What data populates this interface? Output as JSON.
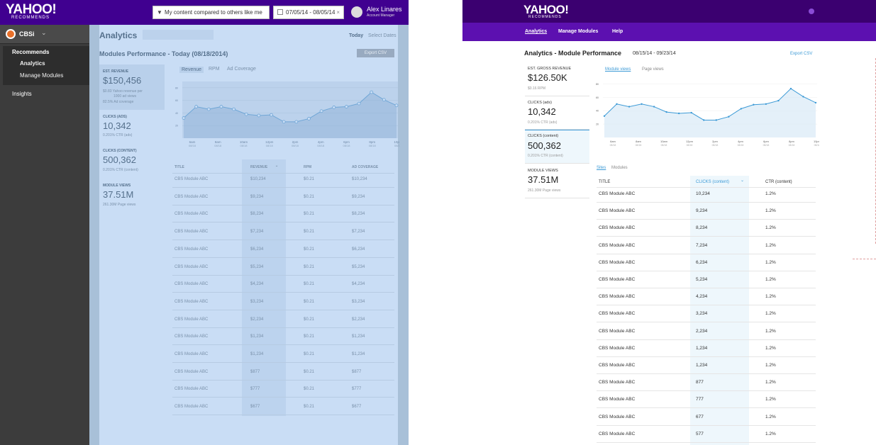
{
  "left": {
    "logo": "YAHOO!",
    "logo_sub": "RECOMMENDS",
    "compare_filter": "My content compared to others like me",
    "date_range": "07/05/14 - 08/05/14",
    "date_clear": "×",
    "user_name": "Alex Linares",
    "user_role": "Account Manager",
    "brand_name": "CBSi",
    "nav": {
      "recommends": "Recommends",
      "analytics": "Analytics",
      "manage_modules": "Manage Modules",
      "insights": "Insights"
    },
    "page_title": "Analytics",
    "today": "Today",
    "select_dates": "Select Dates",
    "subtitle": "Modules Performance - Today (08/18/2014)",
    "export": "Export CSV",
    "metrics": [
      {
        "label": "EST. REVENUE",
        "value": "$150,456",
        "sub1": "$0.83  Yahoo revenue per",
        "sub2": "1000 ad views",
        "sub3": "82.5%  Ad coverage"
      },
      {
        "label": "CLICKS (ADS)",
        "value": "10,342",
        "sub1": "0.201%  CTR (ads)"
      },
      {
        "label": "CLICKS (CONTENT)",
        "value": "500,362",
        "sub1": "0.201%  CTR (content)"
      },
      {
        "label": "MODULE VIEWS",
        "value": "37.51M",
        "sub1": "261.30M  Page views"
      }
    ],
    "tabs": [
      "Revenue",
      "RPM",
      "Ad Coverage"
    ],
    "table_headers": [
      "TITLE",
      "REVENUE",
      "RPM",
      "AD COVERAGE"
    ],
    "rows": [
      [
        "CBS Module ABC",
        "$10,234",
        "$0.21",
        "$10,234"
      ],
      [
        "CBS Module ABC",
        "$9,234",
        "$0.21",
        "$9,234"
      ],
      [
        "CBS Module ABC",
        "$8,234",
        "$0.21",
        "$8,234"
      ],
      [
        "CBS Module ABC",
        "$7,234",
        "$0.21",
        "$7,234"
      ],
      [
        "CBS Module ABC",
        "$6,234",
        "$0.21",
        "$6,234"
      ],
      [
        "CBS Module ABC",
        "$5,234",
        "$0.21",
        "$5,234"
      ],
      [
        "CBS Module ABC",
        "$4,234",
        "$0.21",
        "$4,234"
      ],
      [
        "CBS Module ABC",
        "$3,234",
        "$0.21",
        "$3,234"
      ],
      [
        "CBS Module ABC",
        "$2,234",
        "$0.21",
        "$2,234"
      ],
      [
        "CBS Module ABC",
        "$1,234",
        "$0.21",
        "$1,234"
      ],
      [
        "CBS Module ABC",
        "$1,234",
        "$0.21",
        "$1,234"
      ],
      [
        "CBS Module ABC",
        "$877",
        "$0.21",
        "$877"
      ],
      [
        "CBS Module ABC",
        "$777",
        "$0.21",
        "$777"
      ],
      [
        "CBS Module ABC",
        "$677",
        "$0.21",
        "$677"
      ]
    ]
  },
  "right": {
    "logo": "YAHOO!",
    "logo_sub": "RECOMMENDS",
    "nav": [
      "Analytics",
      "Manage Modules",
      "Help"
    ],
    "title": "Analytics - Module Performance",
    "range": "08/15/14 - 09/23/14",
    "export": "Export CSV",
    "metrics": [
      {
        "label": "EST. GROSS REVENUE",
        "value": "$126.50K",
        "sub": "$0.16  RPM"
      },
      {
        "label": "CLICKS (ads)",
        "value": "10,342",
        "sub": "0.201%  CTR (ads)"
      },
      {
        "label": "CLICKS (content)",
        "value": "500,362",
        "sub": "0.201%  CTR (content)"
      },
      {
        "label": "MODULE VIEWS",
        "value": "37.51M",
        "sub": "261.30M  Page views"
      }
    ],
    "chart_tabs": [
      "Module views",
      "Page views"
    ],
    "table_tabs": [
      "Sites",
      "Modules"
    ],
    "table_headers": [
      "TITLE",
      "CLICKS (content)",
      "CTR (content)"
    ],
    "sort_icon": "⌄",
    "rows": [
      [
        "CBS Module ABC",
        "10,234",
        "1.2%"
      ],
      [
        "CBS Module ABC",
        "9,234",
        "1.2%"
      ],
      [
        "CBS Module ABC",
        "8,234",
        "1.2%"
      ],
      [
        "CBS Module ABC",
        "7,234",
        "1.2%"
      ],
      [
        "CBS Module ABC",
        "6,234",
        "1.2%"
      ],
      [
        "CBS Module ABC",
        "5,234",
        "1.2%"
      ],
      [
        "CBS Module ABC",
        "4,234",
        "1.2%"
      ],
      [
        "CBS Module ABC",
        "3,234",
        "1.2%"
      ],
      [
        "CBS Module ABC",
        "2,234",
        "1.2%"
      ],
      [
        "CBS Module ABC",
        "1,234",
        "1.2%"
      ],
      [
        "CBS Module ABC",
        "1,234",
        "1.2%"
      ],
      [
        "CBS Module ABC",
        "877",
        "1.2%"
      ],
      [
        "CBS Module ABC",
        "777",
        "1.2%"
      ],
      [
        "CBS Module ABC",
        "677",
        "1.2%"
      ],
      [
        "CBS Module ABC",
        "577",
        "1.2%"
      ]
    ]
  },
  "chart_data": [
    {
      "type": "area",
      "x": [
        "6am",
        "8am",
        "10am",
        "12pm",
        "2pm",
        "4pm",
        "6pm",
        "8pm",
        "10pm"
      ],
      "x_sub": [
        "08/18",
        "08/18",
        "08/18",
        "08/18",
        "08/18",
        "08/18",
        "08/18",
        "08/18",
        "08/18"
      ],
      "y_ticks": [
        "80",
        "60",
        "40",
        "20"
      ],
      "ylim": [
        0,
        90
      ],
      "values": [
        32,
        50,
        46,
        50,
        46,
        38,
        36,
        37,
        26,
        26,
        31,
        43,
        49,
        50,
        55,
        73,
        61,
        52
      ],
      "color": "#6fa6d6",
      "grid": true
    },
    {
      "type": "area",
      "x": [
        "6am",
        "8am",
        "10am",
        "12pm",
        "2pm",
        "4pm",
        "6pm",
        "8pm",
        "10pm"
      ],
      "x_sub": [
        "08/18",
        "08/18",
        "08/18",
        "08/18",
        "08/18",
        "08/18",
        "08/18",
        "08/18",
        "08/18"
      ],
      "y_ticks": [
        "80",
        "60",
        "40",
        "20"
      ],
      "ylim": [
        0,
        90
      ],
      "values": [
        32,
        50,
        46,
        50,
        46,
        38,
        36,
        37,
        26,
        26,
        31,
        43,
        49,
        50,
        55,
        73,
        61,
        52
      ],
      "color": "#3c9ad6",
      "grid": true
    }
  ]
}
